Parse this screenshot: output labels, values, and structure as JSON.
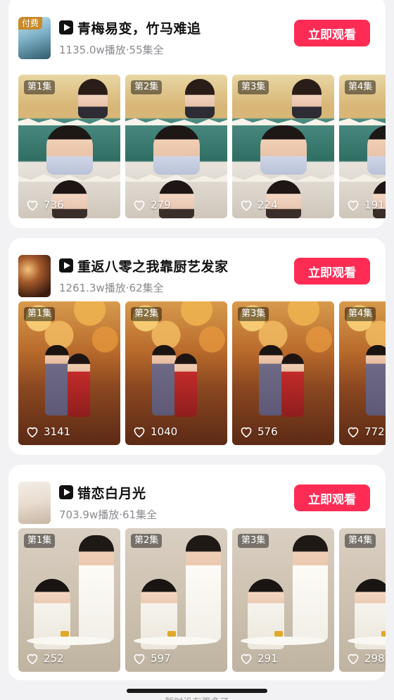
{
  "dramas": [
    {
      "title": "青梅易变，竹马难追",
      "meta": "1135.0w播放·55集全",
      "badge": "付费",
      "button": "立即观看",
      "episodes": [
        {
          "label": "第1集",
          "likes": "736"
        },
        {
          "label": "第2集",
          "likes": "279"
        },
        {
          "label": "第3集",
          "likes": "224"
        },
        {
          "label": "第4集",
          "likes": "191"
        }
      ]
    },
    {
      "title": "重返八零之我靠厨艺发家",
      "meta": "1261.3w播放·62集全",
      "button": "立即观看",
      "episodes": [
        {
          "label": "第1集",
          "likes": "3141"
        },
        {
          "label": "第2集",
          "likes": "1040"
        },
        {
          "label": "第3集",
          "likes": "576"
        },
        {
          "label": "第4集",
          "likes": "772"
        }
      ]
    },
    {
      "title": "错恋白月光",
      "meta": "703.9w播放·61集全",
      "button": "立即观看",
      "episodes": [
        {
          "label": "第1集",
          "likes": "252"
        },
        {
          "label": "第2集",
          "likes": "597"
        },
        {
          "label": "第3集",
          "likes": "291"
        },
        {
          "label": "第4集",
          "likes": "298"
        }
      ]
    }
  ],
  "footer": "暂时没有更多了",
  "colors": {
    "accent": "#fe2c55",
    "meta": "#8a8a8f",
    "background": "#f2f2f4"
  },
  "icons": [
    "play-logo-icon",
    "heart-icon"
  ]
}
